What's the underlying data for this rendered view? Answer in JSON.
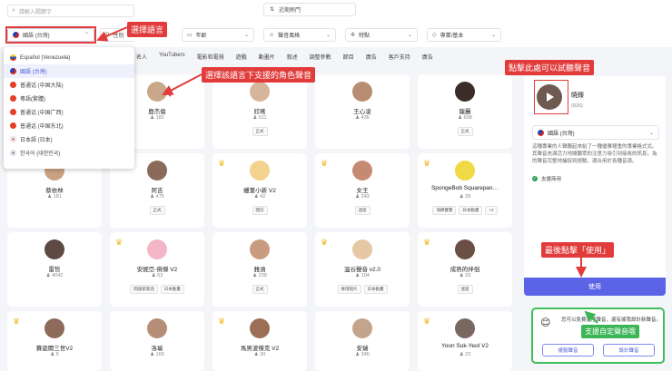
{
  "search": {
    "placeholder": "請輸入關鍵字"
  },
  "sort": {
    "icon": "sort-icon",
    "label": "近期熱門"
  },
  "filters": [
    {
      "id": "language",
      "icon": "taiwan-flag",
      "label": "國語 (台灣)"
    },
    {
      "id": "gender",
      "icon": "gender-icon",
      "label": "性別"
    },
    {
      "id": "age",
      "icon": "calendar-icon",
      "label": "年齡"
    },
    {
      "id": "style",
      "icon": "mood-icon",
      "label": "聲音風格"
    },
    {
      "id": "feature",
      "icon": "sparkle-icon",
      "label": "特點"
    },
    {
      "id": "pro",
      "icon": "tag-icon",
      "label": "專業/基本"
    }
  ],
  "tabs": [
    "名人",
    "YouTubers",
    "電影和電視",
    "遊戲",
    "動畫片",
    "叙述",
    "調整參數",
    "節目",
    "廣告",
    "客戶支持",
    "廣告"
  ],
  "language_dropdown": {
    "items": [
      {
        "flag": "ve",
        "label": "Español (Venezuela)"
      },
      {
        "flag": "tw",
        "label": "國語 (台灣)",
        "selected": true
      },
      {
        "flag": "cn",
        "label": "普通话 (中国大陆)"
      },
      {
        "flag": "cn",
        "label": "粵語(繁體)"
      },
      {
        "flag": "cn",
        "label": "普通话 (中国广西)"
      },
      {
        "flag": "cn",
        "label": "普通话 (中国东北)"
      },
      {
        "flag": "jp",
        "label": "日本語 (日本)"
      },
      {
        "flag": "kr",
        "label": "한국어 (대한민국)"
      }
    ]
  },
  "cards": [
    {
      "name": "",
      "uses": "",
      "tags": [],
      "crown": false
    },
    {
      "name": "鹿杰倫",
      "uses": "182",
      "tags": [],
      "crown": false,
      "heart": true,
      "avatar_color": "#c9a88a"
    },
    {
      "name": "欣瑤",
      "uses": "511",
      "tags": [
        "正式"
      ],
      "crown": false,
      "avatar_color": "#d6b59a"
    },
    {
      "name": "王心凌",
      "uses": "436",
      "tags": [],
      "crown": false,
      "avatar_color": "#b98d74"
    },
    {
      "name": "龍麗",
      "uses": "608",
      "tags": [
        "正式"
      ],
      "crown": false,
      "avatar_color": "#3b2e2a"
    },
    {
      "name": "蔡依林",
      "uses": "181",
      "tags": [],
      "crown": false,
      "avatar_color": "#caa183"
    },
    {
      "name": "阿吉",
      "uses": "475",
      "tags": [
        "正式"
      ],
      "crown": false,
      "avatar_color": "#8a6a58"
    },
    {
      "name": "蠟筆小新 V2",
      "uses": "42",
      "tags": [
        "開兄"
      ],
      "crown": true,
      "avatar_color": "#f2d28c"
    },
    {
      "name": "女王",
      "uses": "243",
      "tags": [
        "迷诞"
      ],
      "crown": true,
      "avatar_color": "#c68a72"
    },
    {
      "name": "SpongeBob Squarepan…",
      "uses": "28",
      "tags": [
        "海綿寶寶",
        "日本動畫",
        "+2"
      ],
      "crown": true,
      "avatar_color": "#f1d845"
    },
    {
      "name": "雷哲",
      "uses": "4042",
      "tags": [],
      "crown": false,
      "avatar_color": "#5d4a42"
    },
    {
      "name": "安妮亞·佛傑 V2",
      "uses": "63",
      "tags": [
        "間諜家家酒",
        "日本動畫"
      ],
      "crown": true,
      "avatar_color": "#f3b6c6"
    },
    {
      "name": "雅涵",
      "uses": "239",
      "tags": [
        "正式"
      ],
      "crown": false,
      "avatar_color": "#c99c82"
    },
    {
      "name": "溫谷聲音 v2.0",
      "uses": "104",
      "tags": [
        "麥環唱片",
        "日本動畫"
      ],
      "crown": true,
      "avatar_color": "#e6c8a4"
    },
    {
      "name": "成熟的伴侶",
      "uses": "33",
      "tags": [
        "迷诞"
      ],
      "crown": true,
      "avatar_color": "#6b4f45"
    },
    {
      "name": "賽迦爾三世V2",
      "uses": "5",
      "tags": [],
      "crown": true,
      "avatar_color": "#8d6b5a"
    },
    {
      "name": "洛瑜",
      "uses": "166",
      "tags": [],
      "crown": false,
      "avatar_color": "#b58e78"
    },
    {
      "name": "馬男波傑克 V2",
      "uses": "30",
      "tags": [],
      "crown": true,
      "avatar_color": "#9a6f55"
    },
    {
      "name": "安瑞",
      "uses": "346",
      "tags": [],
      "crown": false,
      "avatar_color": "#c4a48c"
    },
    {
      "name": "Yoon Suk-Yeol V2",
      "uses": "22",
      "tags": [],
      "crown": true,
      "avatar_color": "#7a6860"
    }
  ],
  "detail_panel": {
    "name": "曉臻",
    "count": "(826)",
    "language": "國語 (台灣)",
    "description": "這種專業的人聲聽起來給了一種優雅穩重的專業格式式。其聲音充滿活力地讓聽眾的注意力吸引到接收的訊息，為的聲音完整地捕捉到經驗，適合用於各種音源。",
    "commercial": "支援商用",
    "use_label": "使用"
  },
  "custom_voice": {
    "text": "您可以免費克隆聲音，還有據我設計新聲音。",
    "btn_clone": "複製聲音",
    "btn_design": "設計聲音"
  },
  "annotations": {
    "select_language": "選擇語言",
    "select_voice": "選擇該語言下支援的角色聲音",
    "click_preview": "點擊此處可以試聽聲音",
    "click_use": "最後點擊「使用」",
    "custom_support": "支援自定聲音哦"
  },
  "colors": {
    "accent": "#5b63e6",
    "annotation_red": "#e23b3b",
    "annotation_green": "#3cb557"
  }
}
